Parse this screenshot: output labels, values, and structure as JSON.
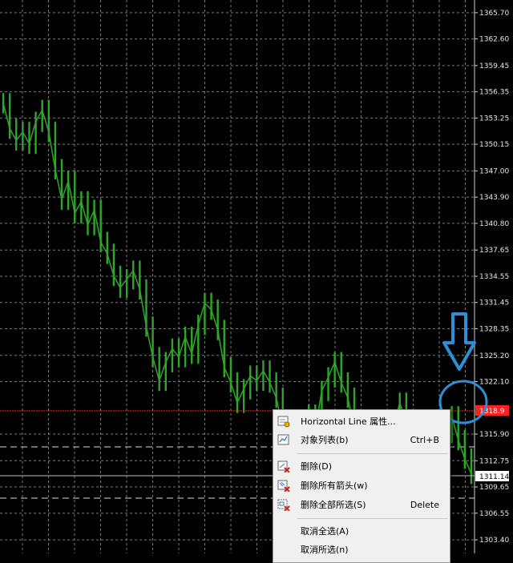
{
  "price_axis": {
    "ticks": [
      "1365.70",
      "1362.60",
      "1359.45",
      "1356.35",
      "1353.25",
      "1350.15",
      "1347.00",
      "1343.90",
      "1340.80",
      "1337.65",
      "1334.55",
      "1331.45",
      "1328.35",
      "1325.20",
      "1322.10",
      "1315.90",
      "1312.75",
      "1309.65",
      "1306.55",
      "1303.40"
    ],
    "line_label": "1318.9",
    "current_price": "1311.14"
  },
  "colors": {
    "background": "#000000",
    "grid": "#7a7a7a",
    "candles": "#2fa52a",
    "horizontal_line": "#ff2020",
    "annotation": "#2f8fd6",
    "price_line": "#c0c0c0"
  },
  "chart_data": {
    "type": "line",
    "title": "",
    "xlabel": "",
    "ylabel": "",
    "ylim": [
      1301.8,
      1367.2
    ],
    "grid": true,
    "series": [
      {
        "values": [
          1355.0,
          1352.0,
          1350.6,
          1351.6,
          1350.2,
          1352.8,
          1354.2,
          1351.6,
          1347.2,
          1343.6,
          1345.8,
          1342.0,
          1343.4,
          1340.6,
          1342.4,
          1338.6,
          1337.2,
          1334.6,
          1333.2,
          1334.2,
          1335.2,
          1333.0,
          1328.6,
          1325.0,
          1322.2,
          1324.4,
          1326.0,
          1325.0,
          1327.4,
          1325.4,
          1328.8,
          1331.4,
          1330.6,
          1328.2,
          1323.8,
          1322.0,
          1319.6,
          1321.2,
          1322.8,
          1322.2,
          1323.4,
          1322.0,
          1320.2,
          1316.6,
          1315.8,
          1317.2,
          1316.0,
          1318.2,
          1316.4,
          1321.0,
          1322.6,
          1324.4,
          1322.0,
          1320.2,
          1316.6,
          1317.6,
          1316.4,
          1316.8,
          1315.4,
          1317.0,
          1316.6,
          1319.6,
          1317.4,
          1315.8,
          1316.2,
          1314.8,
          1315.4,
          1316.8,
          1316.0,
          1318.0,
          1315.2,
          1313.0,
          1311.2
        ]
      }
    ]
  },
  "context_menu": {
    "items": [
      {
        "label": "Horizontal Line 属性...",
        "shortcut": "",
        "icon": "properties-icon"
      },
      {
        "label": "对象列表(b)",
        "shortcut": "Ctrl+B",
        "icon": "object-list-icon"
      },
      {
        "label": "删除(D)",
        "shortcut": "",
        "icon": "delete-icon"
      },
      {
        "label": "删除所有箭头(w)",
        "shortcut": "",
        "icon": "delete-arrows-icon"
      },
      {
        "label": "删除全部所选(S)",
        "shortcut": "Delete",
        "icon": "delete-selected-icon"
      },
      {
        "label": "取消全选(A)",
        "shortcut": "",
        "icon": ""
      },
      {
        "label": "取消所选(n)",
        "shortcut": "",
        "icon": ""
      }
    ]
  }
}
